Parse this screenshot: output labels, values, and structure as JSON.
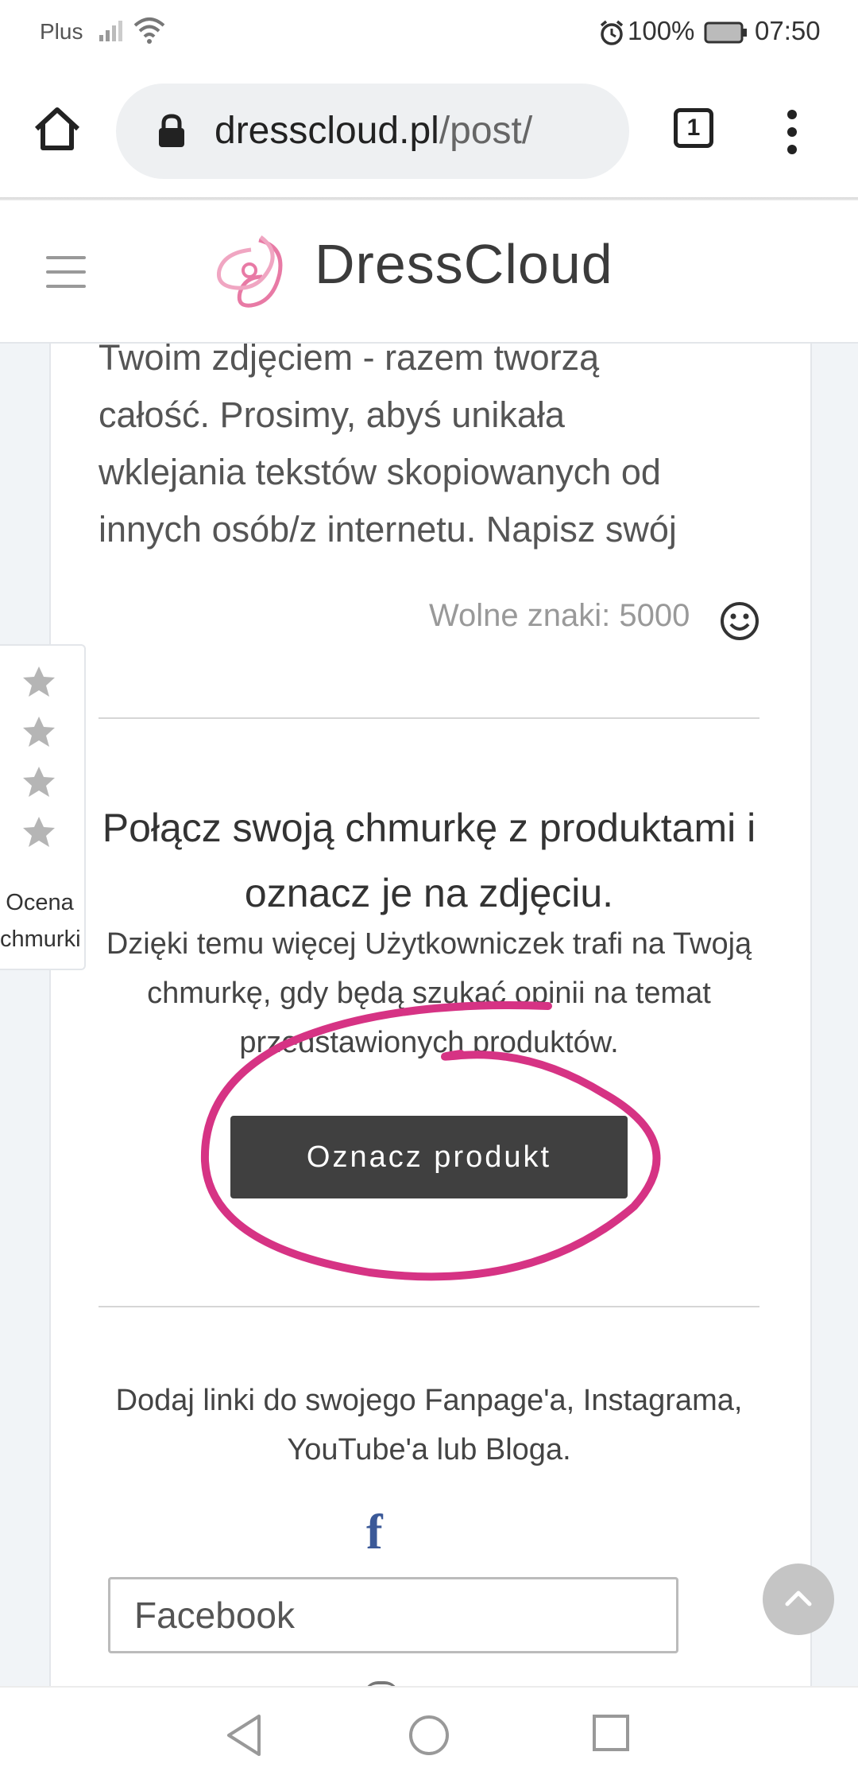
{
  "status_bar": {
    "carrier": "Plus",
    "battery": "100%",
    "time": "07:50"
  },
  "browser": {
    "url_domain": "dresscloud.pl",
    "url_path": "/post/",
    "tab_count": "1"
  },
  "site": {
    "brand": "DressCloud"
  },
  "post_form": {
    "description_lines": [
      "Twoim zdjęciem - razem tworzą",
      "całość. Prosimy, abyś unikała",
      "wklejania tekstów skopiowanych od",
      "innych osób/z internetu. Napisz swój"
    ],
    "free_chars": "Wolne znaki: 5000"
  },
  "tag_section": {
    "heading": "Połącz swoją chmurkę z produktami i oznacz je na zdjęciu.",
    "subtext": "Dzięki temu więcej Użytkowniczek trafi na Twoją chmurkę, gdy będą szukać opinii na temat przedstawionych produktów.",
    "button_label": "Oznacz produkt",
    "annotation_color": "#d63384"
  },
  "links_section": {
    "text": "Dodaj linki do swojego Fanpage'a, Instagrama, YouTube'a lub Bloga.",
    "facebook_icon_glyph": "f",
    "facebook_placeholder": "Facebook"
  },
  "rating_widget": {
    "stars": 4,
    "label_line1": "Ocena",
    "label_line2": "chmurki"
  },
  "icons": {
    "home": "home-icon",
    "lock": "lock-icon",
    "tabs": "tabs-icon",
    "menu": "more-vert-icon",
    "hamburger": "hamburger-icon",
    "smiley": "smiley-icon",
    "scroll_top": "chevron-up-icon",
    "nav_back": "back-triangle-icon",
    "nav_home": "home-circle-icon",
    "nav_recents": "recents-square-icon"
  },
  "colors": {
    "brand_pink": "#e87aa5",
    "button_dark": "#404040",
    "facebook_blue": "#3b5998"
  }
}
